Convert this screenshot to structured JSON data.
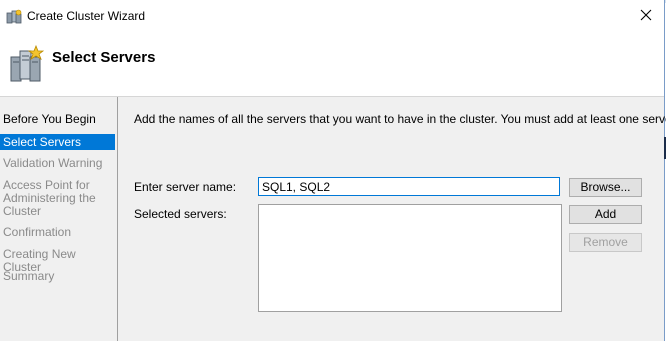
{
  "window": {
    "title": "Create Cluster Wizard"
  },
  "header": {
    "title": "Select Servers"
  },
  "sidebar": {
    "items": [
      {
        "label": "Before You Begin",
        "state": "done"
      },
      {
        "label": "Select Servers",
        "state": "active"
      },
      {
        "label": "Validation Warning",
        "state": "pending"
      },
      {
        "label": "Access Point for Administering the Cluster",
        "state": "pending"
      },
      {
        "label": "Confirmation",
        "state": "pending"
      },
      {
        "label": "Creating New Cluster",
        "state": "pending"
      },
      {
        "label": "Summary",
        "state": "pending"
      }
    ]
  },
  "main": {
    "description": "Add the names of all the servers that you want to have in the cluster. You must add at least one server.",
    "server_name_label": "Enter server name:",
    "server_name_value": "SQL1, SQL2",
    "selected_servers_label": "Selected servers:",
    "selected_servers": [],
    "browse_label": "Browse...",
    "add_label": "Add",
    "remove_label": "Remove"
  },
  "colors": {
    "accent": "#0078d7",
    "panel": "#f0f0f0",
    "disabled_text": "#a0a0a0"
  },
  "icons": {
    "title": "cluster-wizard-icon",
    "header": "server-cluster-icon",
    "close": "close-icon"
  }
}
